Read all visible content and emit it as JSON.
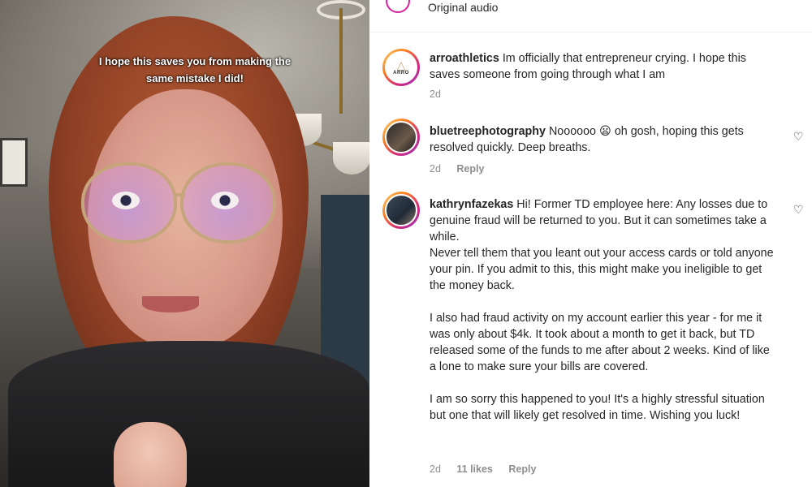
{
  "video": {
    "caption": "I hope this saves you from making the same mistake I did!"
  },
  "audio": {
    "label": "Original audio"
  },
  "comments": [
    {
      "username": "arroathletics",
      "text": "Im officially that entrepreneur crying. I hope this saves someone from going through what I am",
      "avatar_icon": "arro-logo",
      "time": "2d",
      "likes": "",
      "reply_label": ""
    },
    {
      "username": "bluetreephotography",
      "text": "Noooooo 😦 oh gosh, hoping this gets resolved quickly. Deep breaths.",
      "avatar_icon": "profile-photo",
      "time": "2d",
      "likes": "",
      "reply_label": "Reply"
    },
    {
      "username": "kathrynfazekas",
      "text": "Hi! Former TD employee here: Any losses due to genuine fraud will be returned to you. But it can sometimes take a while.\nNever tell them that you leant out your access cards or told anyone your pin. If you admit to this, this might make you ineligible to get the money back.\n\nI also had fraud activity on my account earlier this year - for me it was only about $4k. It took about a month to get it back, but TD released some of the funds to me after about 2 weeks. Kind of like a lone to make sure your bills are covered.\n\nI am so sorry this happened to you! It's a highly stressful situation but one that will likely get resolved in time. Wishing you luck!",
      "avatar_icon": "profile-photo",
      "time": "2d",
      "likes": "11 likes",
      "reply_label": "Reply"
    }
  ],
  "colors": {
    "text": "#262626",
    "meta": "#8e8e8e",
    "story_ring": "#d62976"
  }
}
